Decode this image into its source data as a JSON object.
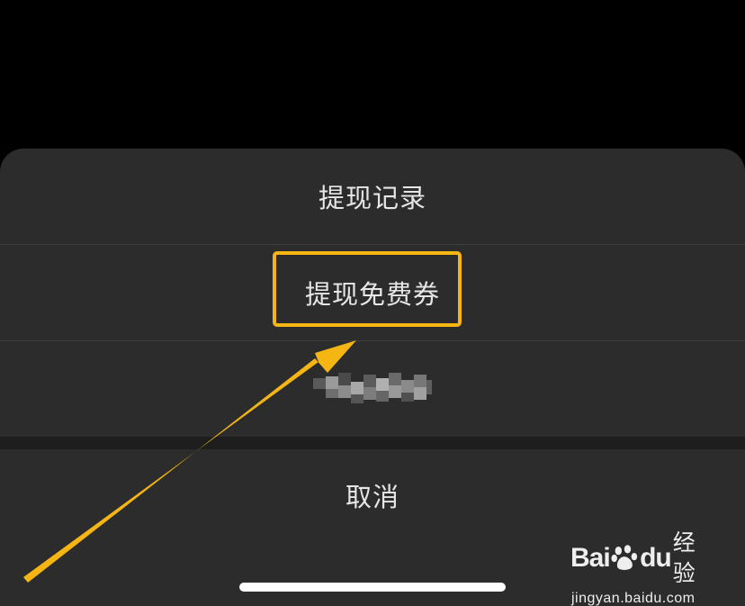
{
  "action_sheet": {
    "items": [
      {
        "label": "提现记录"
      },
      {
        "label": "提现免费券"
      }
    ],
    "cancel_label": "取消"
  },
  "colors": {
    "background": "#000000",
    "sheet": "#2c2c2c",
    "text": "#e6e6e6",
    "highlight": "#f5b512",
    "separator_gap": "#1e1e1e"
  },
  "annotation": {
    "highlighted_item": "提现免费券",
    "arrow_icon": "arrow-icon"
  },
  "watermark": {
    "brand_latin_1": "Bai",
    "brand_latin_2": "du",
    "brand_cn": "经验",
    "url": "jingyan.baidu.com",
    "logo_icon": "paw-icon"
  }
}
